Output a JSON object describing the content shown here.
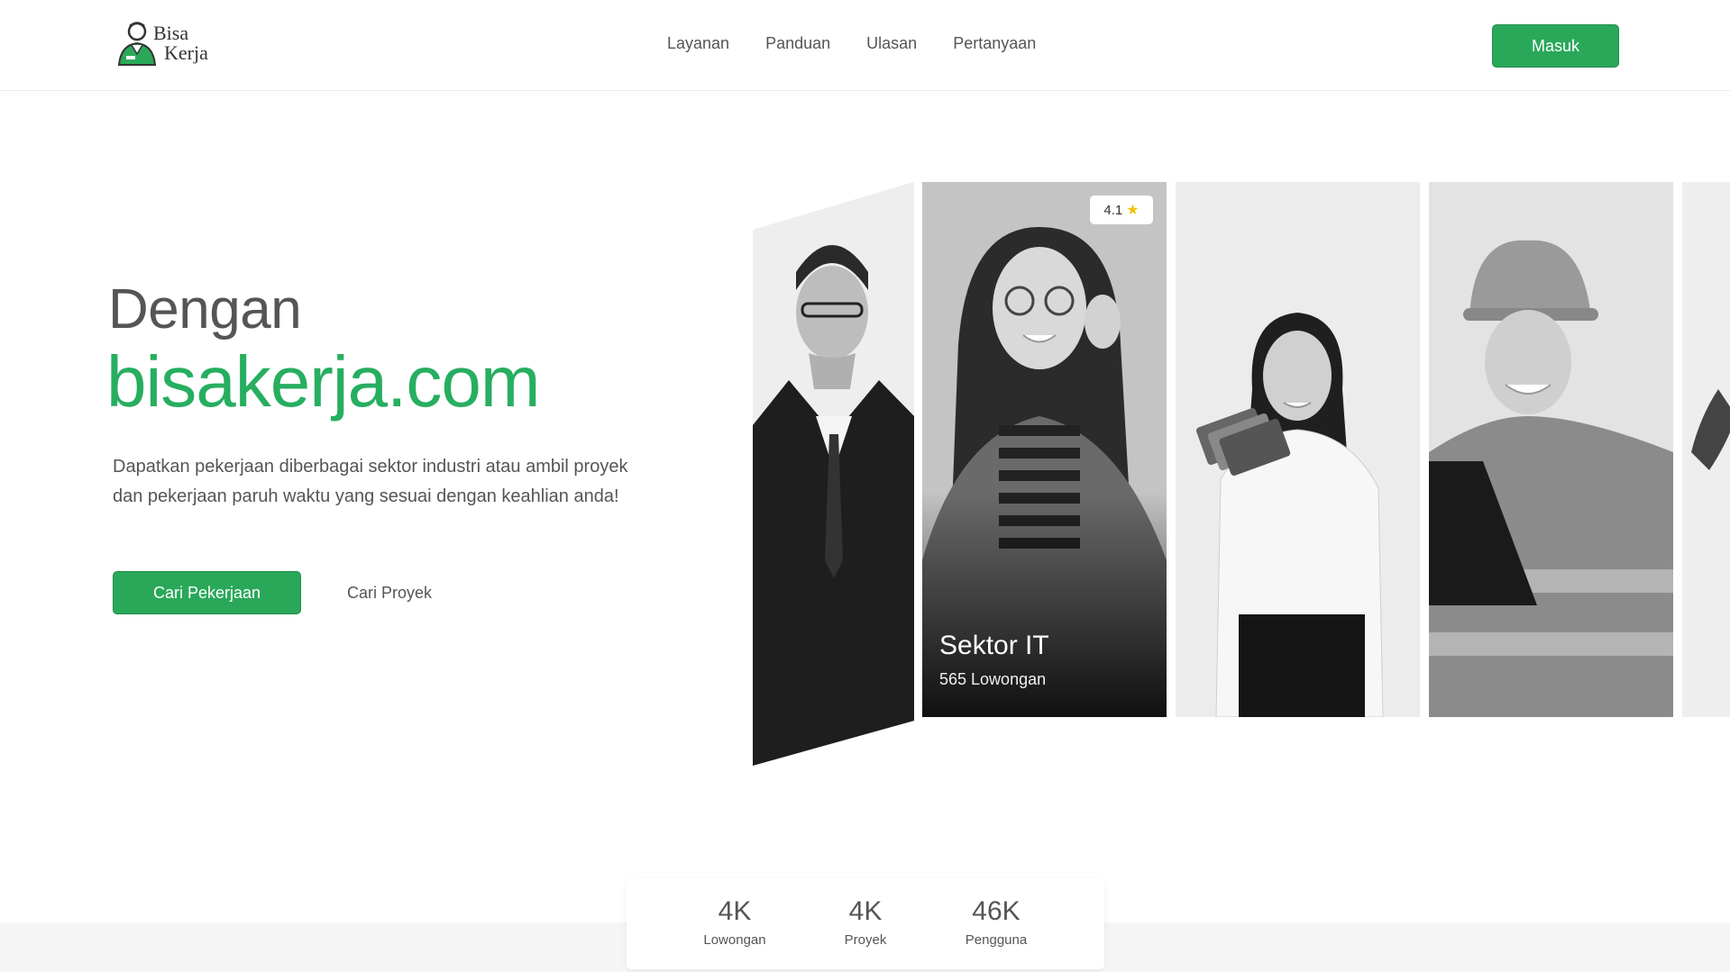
{
  "brand": {
    "line1": "Bisa",
    "line2": "Kerja",
    "color": "#2aa85a"
  },
  "nav": {
    "items": [
      "Layanan",
      "Panduan",
      "Ulasan",
      "Pertanyaan"
    ]
  },
  "header": {
    "login_label": "Masuk"
  },
  "hero": {
    "pre_title": "Dengan",
    "title": "bisakerja.com",
    "description": "Dapatkan pekerjaan diberbagai sektor industri atau ambil proyek dan pekerjaan paruh waktu yang sesuai dengan keahlian anda!",
    "primary_button": "Cari Pekerjaan",
    "secondary_button": "Cari Proyek"
  },
  "featured_card": {
    "rating": "4.1",
    "rating_icon": "star-icon",
    "title": "Sektor IT",
    "subtitle": "565 Lowongan"
  },
  "stats": [
    {
      "value": "4K",
      "label": "Lowongan"
    },
    {
      "value": "4K",
      "label": "Proyek"
    },
    {
      "value": "46K",
      "label": "Pengguna"
    }
  ],
  "colors": {
    "accent": "#2aa85a",
    "text": "#555555"
  }
}
